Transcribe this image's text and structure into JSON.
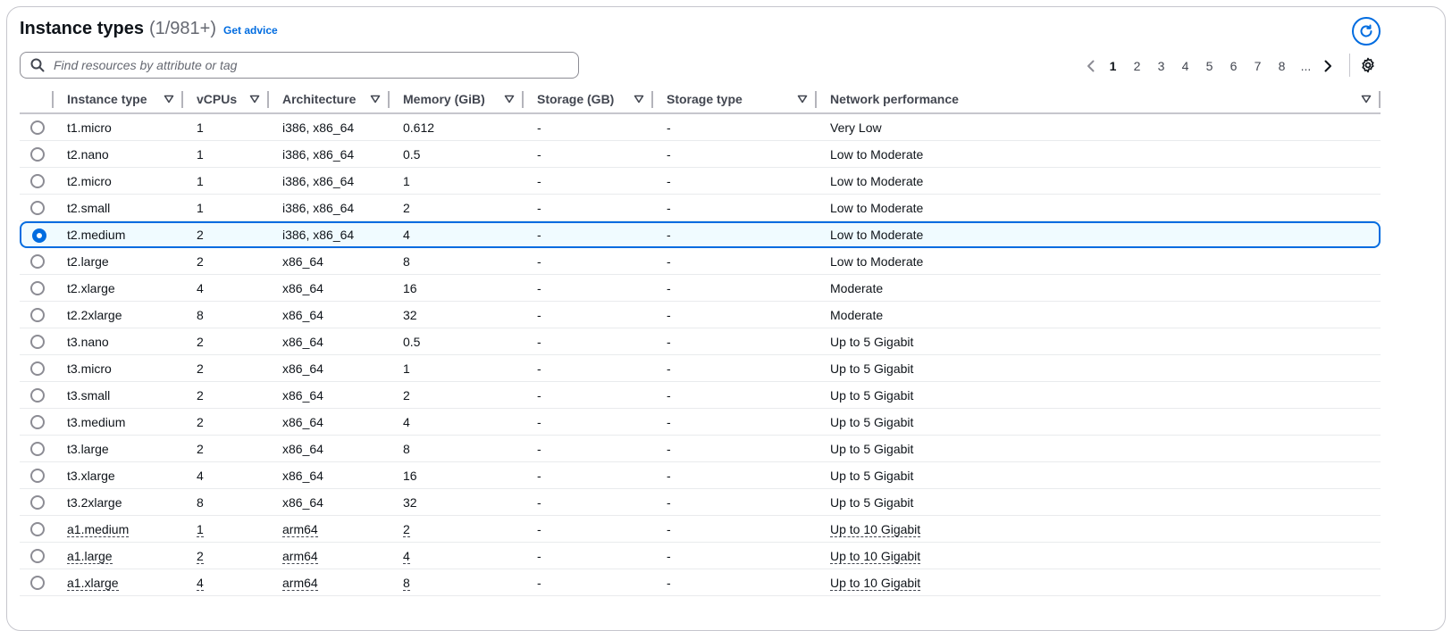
{
  "header": {
    "title": "Instance types",
    "count": "(1/981+)",
    "get_advice": "Get advice"
  },
  "search": {
    "placeholder": "Find resources by attribute or tag",
    "value": ""
  },
  "pagination": {
    "pages": [
      "1",
      "2",
      "3",
      "4",
      "5",
      "6",
      "7",
      "8"
    ],
    "current": "1",
    "ellipsis": "..."
  },
  "columns": [
    "Instance type",
    "vCPUs",
    "Architecture",
    "Memory (GiB)",
    "Storage (GB)",
    "Storage type",
    "Network performance"
  ],
  "rows": [
    {
      "type": "t1.micro",
      "vcpus": "1",
      "arch": "i386, x86_64",
      "memory": "0.612",
      "storage": "-",
      "storage_type": "-",
      "network": "Very Low"
    },
    {
      "type": "t2.nano",
      "vcpus": "1",
      "arch": "i386, x86_64",
      "memory": "0.5",
      "storage": "-",
      "storage_type": "-",
      "network": "Low to Moderate"
    },
    {
      "type": "t2.micro",
      "vcpus": "1",
      "arch": "i386, x86_64",
      "memory": "1",
      "storage": "-",
      "storage_type": "-",
      "network": "Low to Moderate"
    },
    {
      "type": "t2.small",
      "vcpus": "1",
      "arch": "i386, x86_64",
      "memory": "2",
      "storage": "-",
      "storage_type": "-",
      "network": "Low to Moderate"
    },
    {
      "type": "t2.medium",
      "vcpus": "2",
      "arch": "i386, x86_64",
      "memory": "4",
      "storage": "-",
      "storage_type": "-",
      "network": "Low to Moderate",
      "selected": true
    },
    {
      "type": "t2.large",
      "vcpus": "2",
      "arch": "x86_64",
      "memory": "8",
      "storage": "-",
      "storage_type": "-",
      "network": "Low to Moderate"
    },
    {
      "type": "t2.xlarge",
      "vcpus": "4",
      "arch": "x86_64",
      "memory": "16",
      "storage": "-",
      "storage_type": "-",
      "network": "Moderate"
    },
    {
      "type": "t2.2xlarge",
      "vcpus": "8",
      "arch": "x86_64",
      "memory": "32",
      "storage": "-",
      "storage_type": "-",
      "network": "Moderate"
    },
    {
      "type": "t3.nano",
      "vcpus": "2",
      "arch": "x86_64",
      "memory": "0.5",
      "storage": "-",
      "storage_type": "-",
      "network": "Up to 5 Gigabit"
    },
    {
      "type": "t3.micro",
      "vcpus": "2",
      "arch": "x86_64",
      "memory": "1",
      "storage": "-",
      "storage_type": "-",
      "network": "Up to 5 Gigabit"
    },
    {
      "type": "t3.small",
      "vcpus": "2",
      "arch": "x86_64",
      "memory": "2",
      "storage": "-",
      "storage_type": "-",
      "network": "Up to 5 Gigabit"
    },
    {
      "type": "t3.medium",
      "vcpus": "2",
      "arch": "x86_64",
      "memory": "4",
      "storage": "-",
      "storage_type": "-",
      "network": "Up to 5 Gigabit"
    },
    {
      "type": "t3.large",
      "vcpus": "2",
      "arch": "x86_64",
      "memory": "8",
      "storage": "-",
      "storage_type": "-",
      "network": "Up to 5 Gigabit"
    },
    {
      "type": "t3.xlarge",
      "vcpus": "4",
      "arch": "x86_64",
      "memory": "16",
      "storage": "-",
      "storage_type": "-",
      "network": "Up to 5 Gigabit"
    },
    {
      "type": "t3.2xlarge",
      "vcpus": "8",
      "arch": "x86_64",
      "memory": "32",
      "storage": "-",
      "storage_type": "-",
      "network": "Up to 5 Gigabit"
    },
    {
      "type": "a1.medium",
      "vcpus": "1",
      "arch": "arm64",
      "memory": "2",
      "storage": "-",
      "storage_type": "-",
      "network": "Up to 10 Gigabit",
      "dotted": true
    },
    {
      "type": "a1.large",
      "vcpus": "2",
      "arch": "arm64",
      "memory": "4",
      "storage": "-",
      "storage_type": "-",
      "network": "Up to 10 Gigabit",
      "dotted": true
    },
    {
      "type": "a1.xlarge",
      "vcpus": "4",
      "arch": "arm64",
      "memory": "8",
      "storage": "-",
      "storage_type": "-",
      "network": "Up to 10 Gigabit",
      "dotted": true
    }
  ],
  "colors": {
    "accent": "#006ce0",
    "selected_bg": "#f0fbff",
    "border": "#c6c6cd"
  },
  "icons": [
    "refresh-icon",
    "search-icon",
    "chevron-left-icon",
    "chevron-right-icon",
    "settings-gear-icon",
    "sort-caret-icon"
  ]
}
